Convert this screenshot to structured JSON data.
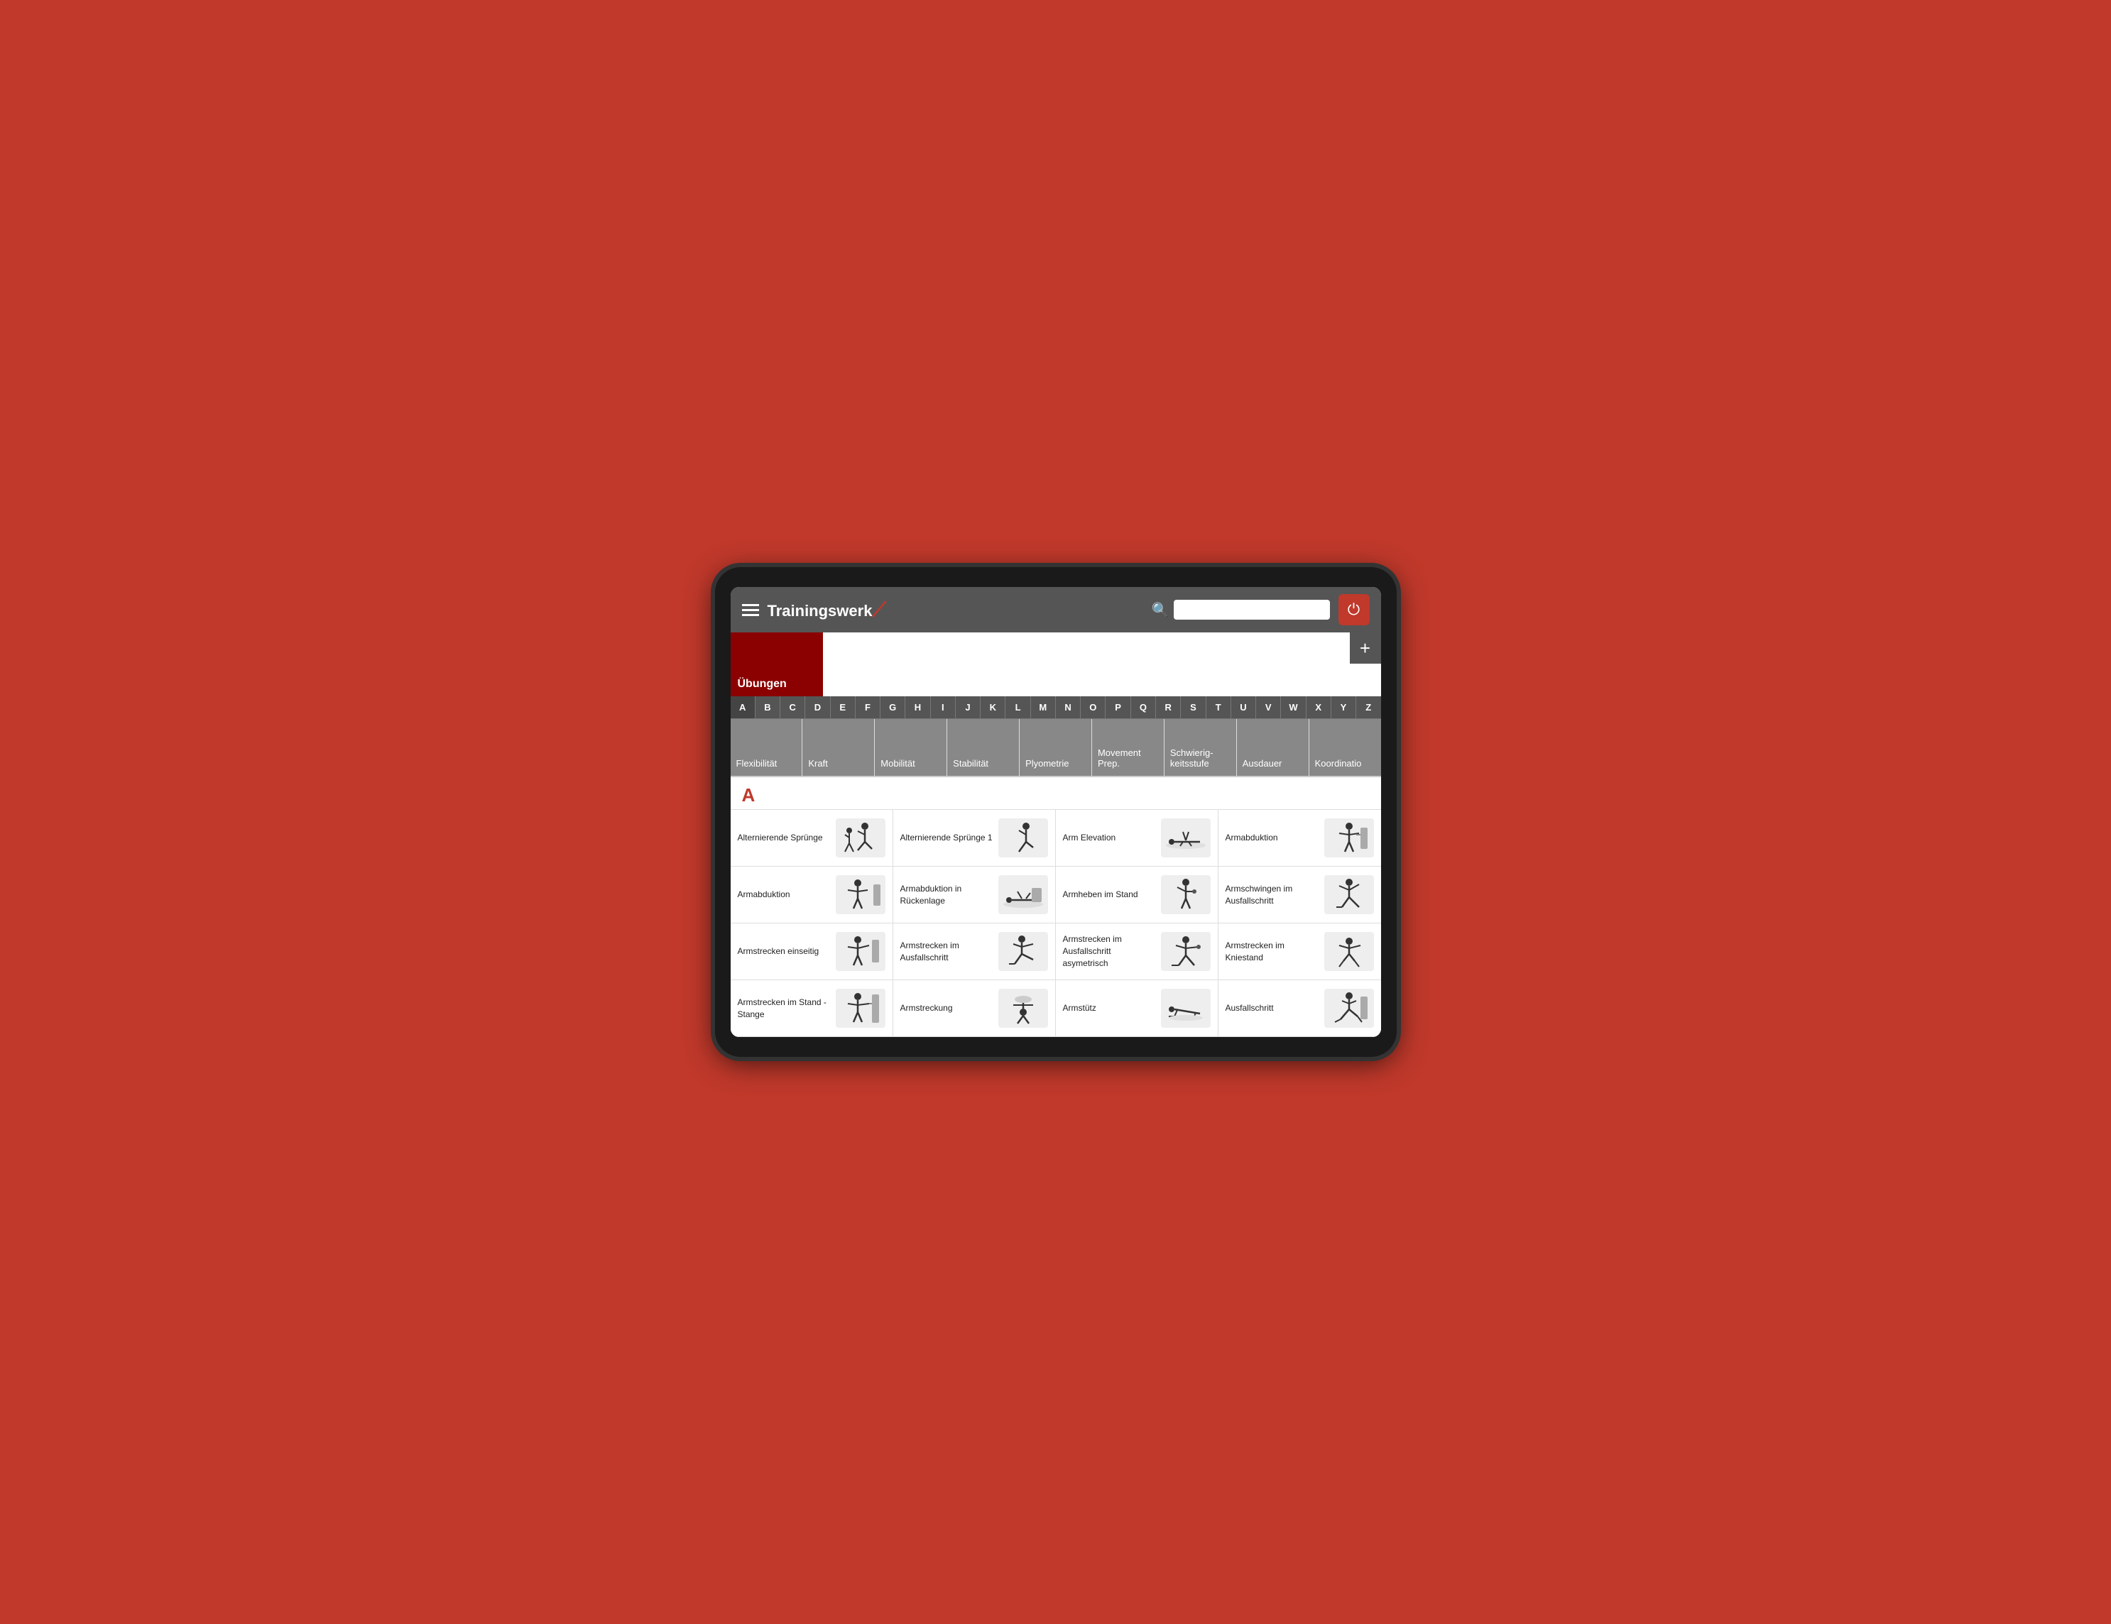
{
  "header": {
    "logo": "Trainingswerk",
    "search_placeholder": "",
    "search_icon": "🔍",
    "power_icon": "⏻",
    "menu_icon": "☰"
  },
  "category": {
    "title": "Übungen",
    "add_label": "+"
  },
  "alpha_nav": [
    "A",
    "B",
    "C",
    "D",
    "E",
    "F",
    "G",
    "H",
    "I",
    "J",
    "K",
    "L",
    "M",
    "N",
    "O",
    "P",
    "Q",
    "R",
    "S",
    "T",
    "U",
    "V",
    "W",
    "X",
    "Y",
    "Z"
  ],
  "filters": [
    "Flexibilität",
    "Kraft",
    "Mobilität",
    "Stabilität",
    "Plyometrie",
    "Movement Prep.",
    "Schwierig-keitsstufe",
    "Ausdauer",
    "Koordinatio"
  ],
  "section_label": "A",
  "exercises": [
    {
      "name": "Alternierende Sprünge",
      "has_image": true
    },
    {
      "name": "Alternierende Sprünge 1",
      "has_image": true
    },
    {
      "name": "Arm Elevation",
      "has_image": true
    },
    {
      "name": "Armabduktion",
      "has_image": true
    },
    {
      "name": "Armabduktion",
      "has_image": true
    },
    {
      "name": "Armabduktion in Rückenlage",
      "has_image": true
    },
    {
      "name": "Armheben im Stand",
      "has_image": true
    },
    {
      "name": "Armschwingen im Ausfallschritt",
      "has_image": true
    },
    {
      "name": "Armstrecken einseitig",
      "has_image": true
    },
    {
      "name": "Armstrecken im Ausfallschritt",
      "has_image": true
    },
    {
      "name": "Armstrecken im Ausfallschritt asymetrisch",
      "has_image": true
    },
    {
      "name": "Armstrecken im Kniestand",
      "has_image": true
    },
    {
      "name": "Armstrecken im Stand - Stange",
      "has_image": true
    },
    {
      "name": "Armstreckung",
      "has_image": true
    },
    {
      "name": "Armstütz",
      "has_image": true
    },
    {
      "name": "Ausfallschritt",
      "has_image": true
    }
  ]
}
